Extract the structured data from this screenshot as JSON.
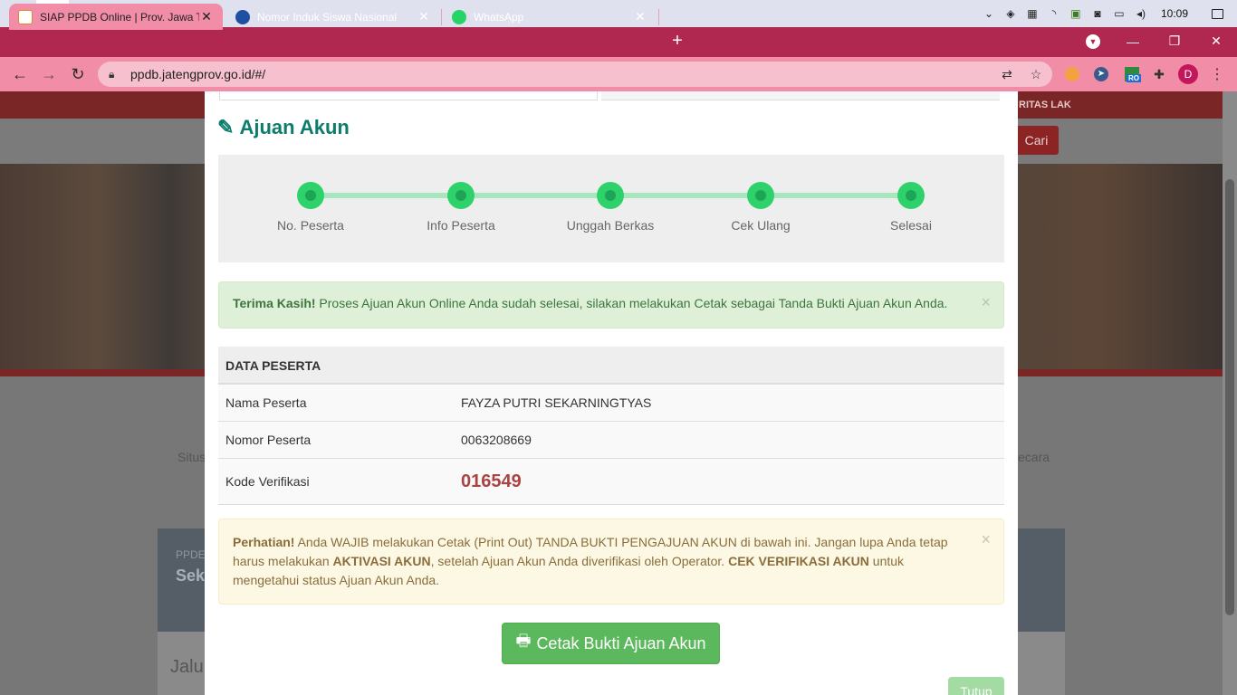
{
  "taskbar": {
    "clock": "10:09",
    "tray_icons": [
      "chevron-up-icon",
      "dropbox-icon",
      "security-icon",
      "wifi-icon",
      "nvidia-icon",
      "usb-icon",
      "battery-icon",
      "volume-icon"
    ]
  },
  "browser": {
    "tabs": [
      {
        "title": "SIAP PPDB Online | Prov. Jawa Te",
        "active": true
      },
      {
        "title": "Nomor Induk Siswa Nasional",
        "active": false
      },
      {
        "title": "WhatsApp",
        "active": false
      }
    ],
    "url": "ppdb.jatengprov.go.id/#/",
    "profile_initial": "D",
    "extension_badge": "RO",
    "colors": {
      "tabstrip": "#b0284f",
      "toolbar": "#f18da7"
    }
  },
  "background_page": {
    "strip_text": "RITAS LAK",
    "search_button": "Cari",
    "left_text": "Situs",
    "right_text": "ecara",
    "card_small": "PPDE",
    "card_title": "Sek",
    "card_body": "Jalu"
  },
  "modal": {
    "title": "Ajuan Akun",
    "steps": [
      "No. Peserta",
      "Info Peserta",
      "Unggah Berkas",
      "Cek Ulang",
      "Selesai"
    ],
    "success_alert": {
      "strong": "Terima Kasih!",
      "text": " Proses Ajuan Akun Online Anda sudah selesai, silakan melakukan Cetak sebagai Tanda Bukti Ajuan Akun Anda.",
      "close": "×"
    },
    "data_table": {
      "header": "DATA PESERTA",
      "rows": [
        {
          "label": "Nama Peserta",
          "value": "FAYZA PUTRI SEKARNINGTYAS"
        },
        {
          "label": "Nomor Peserta",
          "value": "0063208669"
        },
        {
          "label": "Kode Verifikasi",
          "value": "016549"
        }
      ]
    },
    "warning_alert": {
      "strong1": "Perhatian!",
      "text1": " Anda WAJIB melakukan Cetak (Print Out) TANDA BUKTI PENGAJUAN AKUN di bawah ini. Jangan lupa Anda tetap harus melakukan ",
      "strong2": "AKTIVASI AKUN",
      "text2": ", setelah Ajuan Akun Anda diverifikasi oleh Operator. ",
      "strong3": "CEK VERIFIKASI AKUN",
      "text3": " untuk mengetahui status Ajuan Akun Anda.",
      "close": "×"
    },
    "print_button": "Cetak Bukti Ajuan Akun",
    "close_button": "Tutup"
  }
}
